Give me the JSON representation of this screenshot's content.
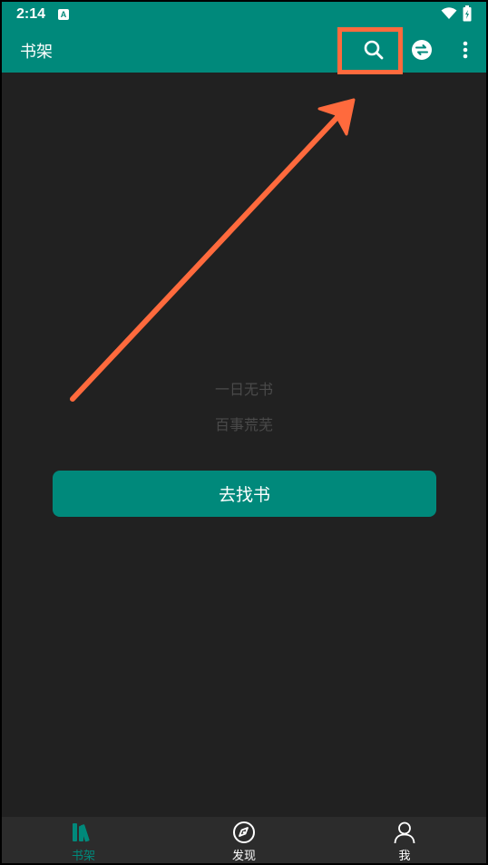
{
  "status_bar": {
    "time": "2:14",
    "app_icon_letter": "A"
  },
  "toolbar": {
    "title": "书架"
  },
  "empty_state": {
    "line1": "一日无书",
    "line2": "百事荒芜"
  },
  "find_button": {
    "label": "去找书"
  },
  "bottom_nav": {
    "items": [
      {
        "label": "书架",
        "icon": "bookshelf-icon",
        "active": true
      },
      {
        "label": "发现",
        "icon": "compass-icon",
        "active": false
      },
      {
        "label": "我",
        "icon": "person-icon",
        "active": false
      }
    ]
  },
  "colors": {
    "primary": "#00897b",
    "background": "#212121",
    "annotation": "#ff6a3d"
  }
}
